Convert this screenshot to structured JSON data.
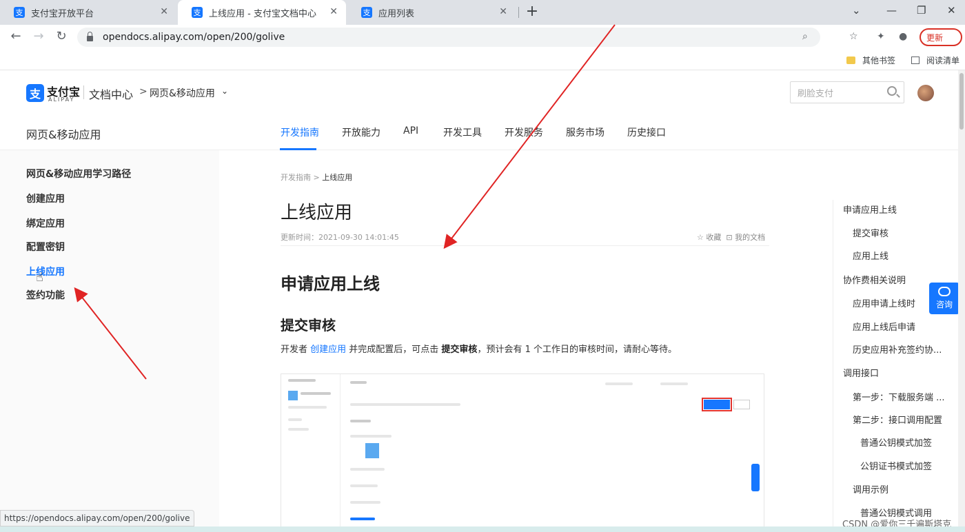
{
  "browser": {
    "tabs": [
      {
        "title": "支付宝开放平台",
        "favicon": "支"
      },
      {
        "title": "上线应用 - 支付宝文档中心",
        "favicon": "支"
      },
      {
        "title": "应用列表",
        "favicon": "支"
      }
    ],
    "new_tab_label": "+",
    "window_controls": [
      "⌄",
      "—",
      "❐",
      "✕"
    ],
    "url": "opendocs.alipay.com/open/200/golive",
    "profile_button_label": "更新",
    "bookmarks": [
      {
        "label": "其他书签"
      },
      {
        "label": "阅读清单"
      }
    ],
    "status_url": "https://opendocs.alipay.com/open/200/golive"
  },
  "header": {
    "logo_cn": "支付宝",
    "logo_en": "ALIPAY",
    "logo_mark": "支",
    "doc_center": "文档中心",
    "crumb_sep": ">",
    "product": "网页&移动应用",
    "product_caret": "⌄",
    "search_placeholder": "刷脸支付",
    "product_title": "网页&移动应用",
    "nav_tabs": [
      "开发指南",
      "开放能力",
      "API",
      "开发工具",
      "开发服务",
      "服务市场",
      "历史接口"
    ]
  },
  "sidebar": {
    "items": [
      {
        "label": "网页&移动应用学习路径"
      },
      {
        "label": "创建应用"
      },
      {
        "label": "绑定应用"
      },
      {
        "label": "配置密钥"
      },
      {
        "label": "上线应用"
      },
      {
        "label": "签约功能"
      }
    ],
    "active_index": 4
  },
  "article": {
    "breadcrumb_parent": "开发指南",
    "breadcrumb_sep": " > ",
    "breadcrumb_current": "上线应用",
    "title": "上线应用",
    "update_time": "更新时间：2021-09-30 14:01:45",
    "favorite_label": "☆ 收藏",
    "my_docs_label": "⊡ 我的文档",
    "h2": "申请应用上线",
    "h3": "提交审核",
    "para_prefix": "开发者 ",
    "para_link": "创建应用",
    "para_mid": " 并完成配置后，可点击 ",
    "para_bold": "提交审核",
    "para_suffix": "，预计会有 1 个工作日的审核时间，请耐心等待。"
  },
  "toc": {
    "items": [
      {
        "label": "申请应用上线",
        "level": 1
      },
      {
        "label": "提交审核",
        "level": 2
      },
      {
        "label": "应用上线",
        "level": 2
      },
      {
        "label": "协作费相关说明",
        "level": 1
      },
      {
        "label": "应用申请上线时",
        "level": 2
      },
      {
        "label": "应用上线后申请",
        "level": 2
      },
      {
        "label": "历史应用补充签约协...",
        "level": 2
      },
      {
        "label": "调用接口",
        "level": 1
      },
      {
        "label": "第一步：下载服务端 ...",
        "level": 2
      },
      {
        "label": "第二步：接口调用配置",
        "level": 2
      },
      {
        "label": "普通公钥模式加签",
        "level": 3
      },
      {
        "label": "公钥证书模式加签",
        "level": 3
      },
      {
        "label": "调用示例",
        "level": 2
      },
      {
        "label": "普通公钥模式调用",
        "level": 3
      }
    ]
  },
  "consult_label": "咨询",
  "watermark": "CSDN @爱你三千遍斯塔克",
  "colors": {
    "accent": "#1677ff",
    "annotation_arrow": "#e02424"
  }
}
